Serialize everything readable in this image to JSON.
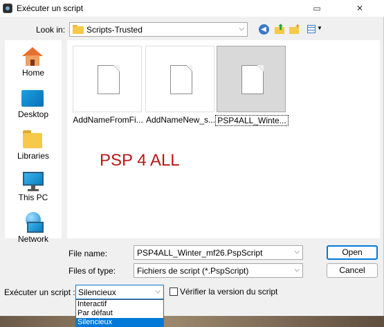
{
  "window": {
    "title": "Exécuter un script",
    "restore_glyph": "▭",
    "close_glyph": "✕"
  },
  "lookin": {
    "label": "Look in:",
    "value": "Scripts-Trusted",
    "arrow": "⌵"
  },
  "toolbar": {
    "back_glyph": "◀",
    "up_glyph": "⬆",
    "new_folder_glyph": "✦",
    "view_arrow": "▼"
  },
  "places": [
    {
      "label": "Home",
      "icon": "home-icon"
    },
    {
      "label": "Desktop",
      "icon": "desktop-icon"
    },
    {
      "label": "Libraries",
      "icon": "libraries-icon"
    },
    {
      "label": "This PC",
      "icon": "this-pc-icon"
    },
    {
      "label": "Network",
      "icon": "network-icon"
    }
  ],
  "files": [
    {
      "name": "AddNameFromFi...",
      "selected": false
    },
    {
      "name": "AddNameNew_s...",
      "selected": false
    },
    {
      "name": "PSP4ALL_Winte...",
      "selected": true
    }
  ],
  "watermark": "PSP 4 ALL",
  "filename": {
    "label": "File name:",
    "value": "PSP4ALL_Winter_mf26.PspScript",
    "arrow": "⌵"
  },
  "filetype": {
    "label": "Files of type:",
    "value": "Fichiers de script (*.PspScript)",
    "arrow": "⌵"
  },
  "buttons": {
    "open": "Open",
    "cancel": "Cancel"
  },
  "script_mode": {
    "label": "Exécuter un script :",
    "value": "Silencieux",
    "arrow": "⌵",
    "options": [
      "Interactif",
      "Par défaut",
      "Silencieux"
    ],
    "selected_index": 2
  },
  "verify": {
    "label": "Vérifier la version du script",
    "checked": false
  },
  "colors": {
    "accent": "#0078d7",
    "watermark": "#b81818"
  }
}
